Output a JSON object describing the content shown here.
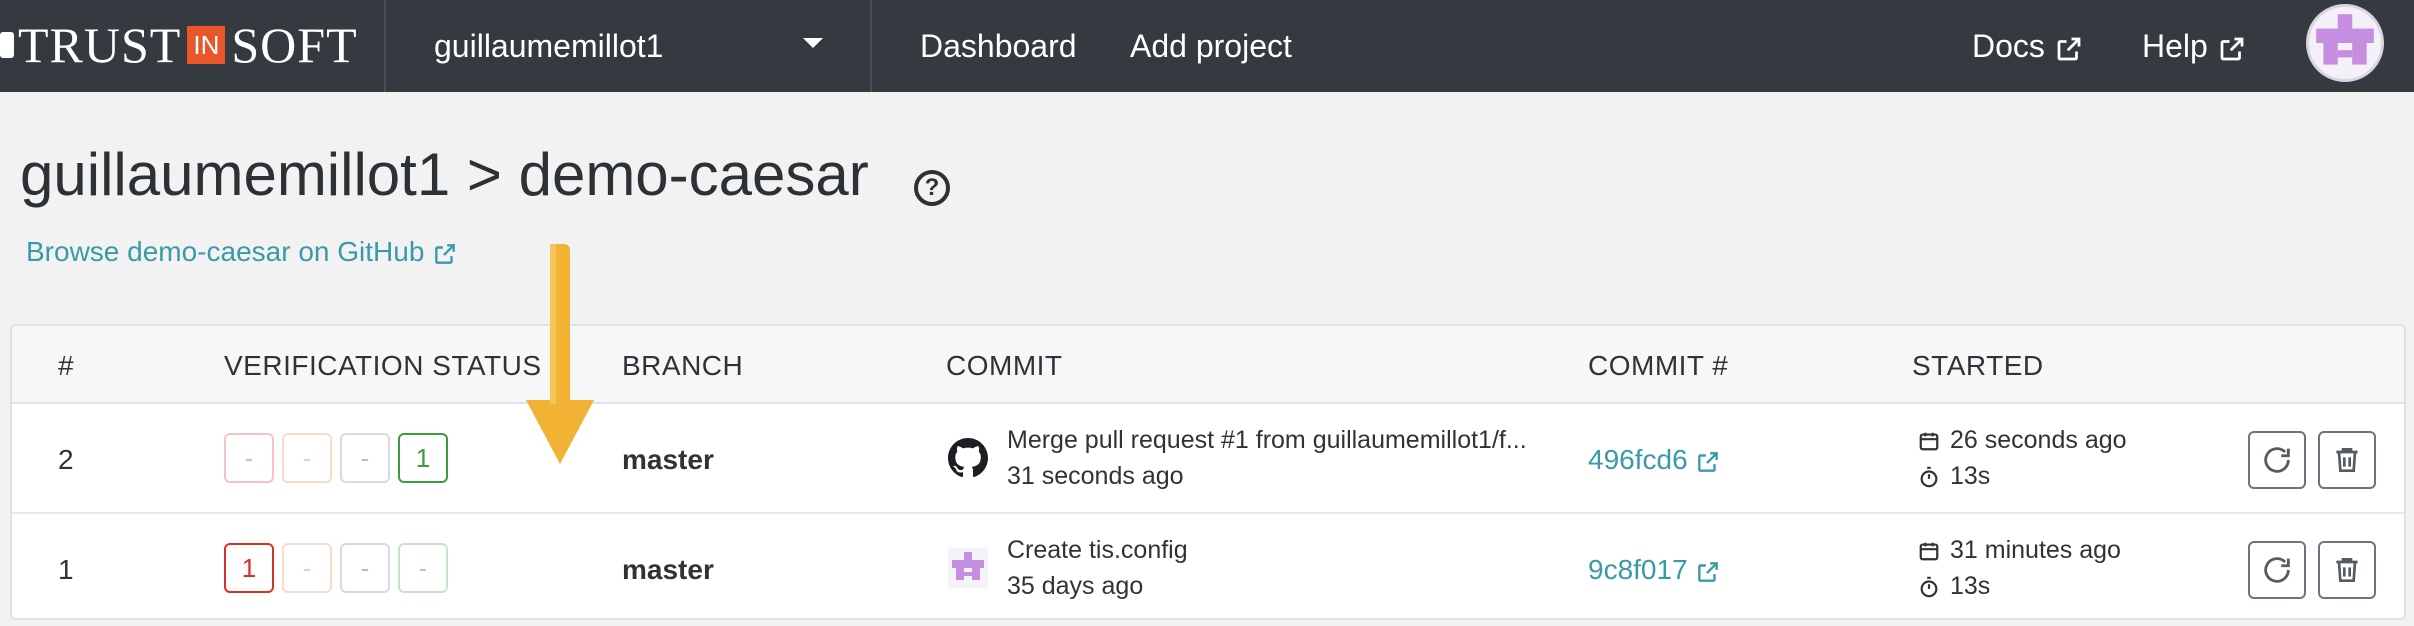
{
  "navbar": {
    "logo_left": "TRUST",
    "logo_in": "IN",
    "logo_right": "SOFT",
    "org_name": "guillaumemillot1",
    "links": {
      "dashboard": "Dashboard",
      "add_project": "Add project",
      "docs": "Docs",
      "help": "Help"
    }
  },
  "page": {
    "title": "guillaumemillot1 > demo-caesar",
    "help_glyph": "?",
    "github_link": "Browse demo-caesar on GitHub"
  },
  "table": {
    "headers": {
      "num": "#",
      "status": "VERIFICATION STATUS",
      "branch": "BRANCH",
      "commit": "COMMIT",
      "commit_hash": "COMMIT #",
      "started": "STARTED"
    },
    "rows": [
      {
        "num": "2",
        "badges": [
          "-",
          "-",
          "-",
          "1"
        ],
        "branch": "master",
        "commit_icon": "github-icon",
        "commit_message": "Merge pull request #1 from guillaumemillot1/f...",
        "commit_time": "31 seconds ago",
        "commit_hash": "496fcd6",
        "started": "26 seconds ago",
        "duration": "13s"
      },
      {
        "num": "1",
        "badges": [
          "1",
          "-",
          "-",
          "-"
        ],
        "branch": "master",
        "commit_icon": "user-avatar-icon",
        "commit_message": "Create tis.config",
        "commit_time": "35 days ago",
        "commit_hash": "9c8f017",
        "started": "31 minutes ago",
        "duration": "13s"
      }
    ]
  },
  "colors": {
    "navbar": "#343a40",
    "link": "#3a9aa8",
    "badge_error": "#d9302c",
    "badge_warning": "#f0b27a",
    "badge_neutral": "#b8bcc0",
    "badge_ok": "#3e9b3a",
    "annotation_arrow": "#f2b233",
    "avatar": "#c58ee0"
  }
}
